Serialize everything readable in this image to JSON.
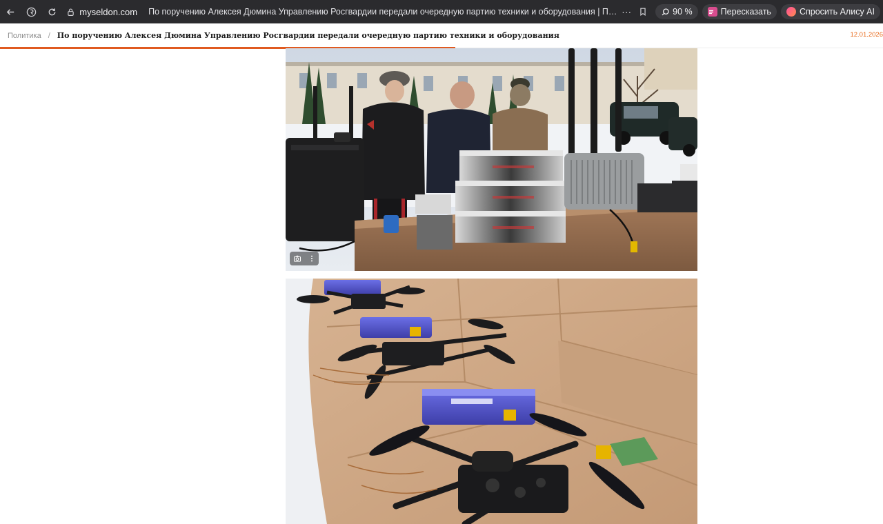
{
  "browser": {
    "domain": "myseldon.com",
    "page_title": "По поручению Алексея Дюмина Управлению Росгвардии передали очередную партию техники и оборудования | Политика | Селдон Новости",
    "zoom": "90 %",
    "retell_label": "Пересказать",
    "alice_label": "Спросить Алису AI",
    "more_label": "···",
    "icons": [
      "back-icon",
      "yandex-icon",
      "reload-icon",
      "lock-icon",
      "bookmark-icon",
      "search-zoom-icon"
    ]
  },
  "header": {
    "category": "Политика",
    "separator": "/",
    "title": "По поручению Алексея Дюмина Управлению Росгвардии передали очередную партию техники и оборудования",
    "date": "12.01.2026",
    "read_progress": 0.516,
    "accent_color": "#e05a20"
  },
  "photos": [
    {
      "alt": "photo-equipment-handover"
    },
    {
      "alt": "photo-fpv-drones"
    }
  ]
}
